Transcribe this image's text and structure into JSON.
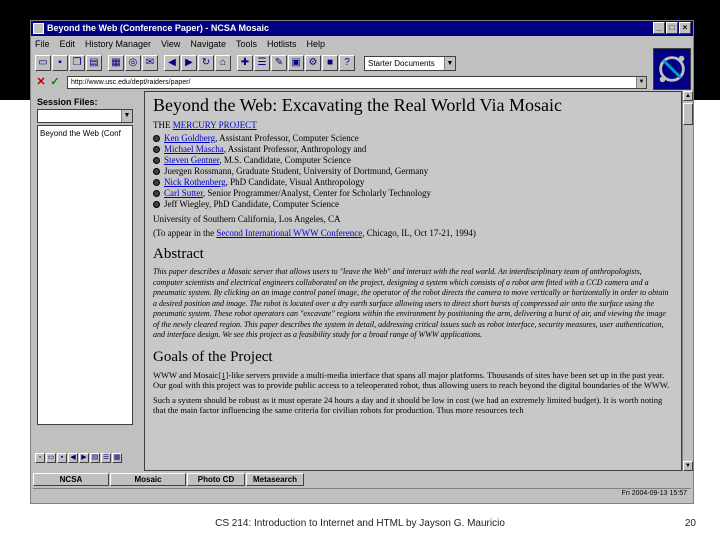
{
  "window": {
    "title": "Beyond the Web (Conference Paper) - NCSA Mosaic",
    "buttons": [
      "_",
      "□",
      "×"
    ]
  },
  "menu": [
    "File",
    "Edit",
    "History Manager",
    "View",
    "Navigate",
    "Tools",
    "Hotlists",
    "Help"
  ],
  "toolbar": {
    "hotlist_value": "Starter Documents"
  },
  "url_bar": {
    "value": "http://www.usc.edu/dept/raiders/paper/"
  },
  "session": {
    "label": "Session Files:",
    "tree_item": "Beyond the Web (Conf"
  },
  "page": {
    "title": "Beyond the Web: Excavating the Real World Via Mosaic",
    "project_prefix": "THE",
    "project_link": "MERCURY PROJECT",
    "authors": [
      {
        "name": "Ken Goldberg",
        "role": ", Assistant Professor, Computer Science"
      },
      {
        "name": "Michael Mascha",
        "role": ", Assistant Professor, Anthropology and"
      },
      {
        "name": "Steven Gentner",
        "role": ", M.S. Candidate, Computer Science"
      },
      {
        "name": "Juergen Rossmann",
        "role": ", Graduate Student, University of Dortmund, Germany"
      },
      {
        "name": "Nick Rothenberg",
        "role": ", PhD Candidate, Visual Anthropology"
      },
      {
        "name": "Carl Sutter",
        "role": ", Senior Programmer/Analyst, Center for Scholarly Technology"
      },
      {
        "name": "Jeff Wiegley",
        "role": ", PhD Candidate, Computer Science"
      }
    ],
    "affiliation": "University of Southern California, Los Angeles, CA",
    "conference_prefix": "(To appear in the",
    "conference_link": "Second International WWW Conference",
    "conference_suffix": ", Chicago, IL, Oct 17-21, 1994)",
    "abstract_heading": "Abstract",
    "abstract_text": "This paper describes a Mosaic server that allows users to \"leave the Web\" and interact with the real world. An interdisciplinary team of anthropologists, computer scientists and electrical engineers collaborated on the project, designing a system which consists of a robot arm fitted with a CCD camera and a pneumatic system. By clicking on an image control panel image, the operator of the robot directs the camera to move vertically or horizontally in order to obtain a desired position and image. The robot is located over a dry earth surface allowing users to direct short bursts of compressed air onto the surface using the pneumatic system. These robot operators can \"excavate\" regions within the environment by positioning the arm, delivering a burst of air, and viewing the image of the newly cleared region. This paper describes the system in detail, addressing critical issues such as robot interface, security measures, user authentication, and interface design. We see this project as a feasibility study for a broad range of WWW applications.",
    "goals_heading": "Goals of the Project",
    "goals_p1_a": "WWW and Mosaic",
    "goals_p1_link": "[1]",
    "goals_p1_b": "-like servers provide a multi-media interface that spans all major platforms. Thousands of sites have been set up in the past year. Our goal with this project was to provide public access to a teleoperated robot, thus allowing users to reach beyond the digital boundaries of the WWW.",
    "goals_p2": "Such a system should be robust as it must operate 24 hours a day and it should be low in cost (we had an extremely limited budget). It is worth noting that the main factor influencing the same criteria for civilian robots for production. Thus more resources tech"
  },
  "status_tabs": [
    "NCSA",
    "Mosaic",
    "Photo CD",
    "Metasearch"
  ],
  "status_time": "Fri 2004-09-13 15:57",
  "footer": {
    "caption": "CS 214: Introduction to Internet and HTML by Jayson G. Mauricio",
    "page_number": "20"
  }
}
